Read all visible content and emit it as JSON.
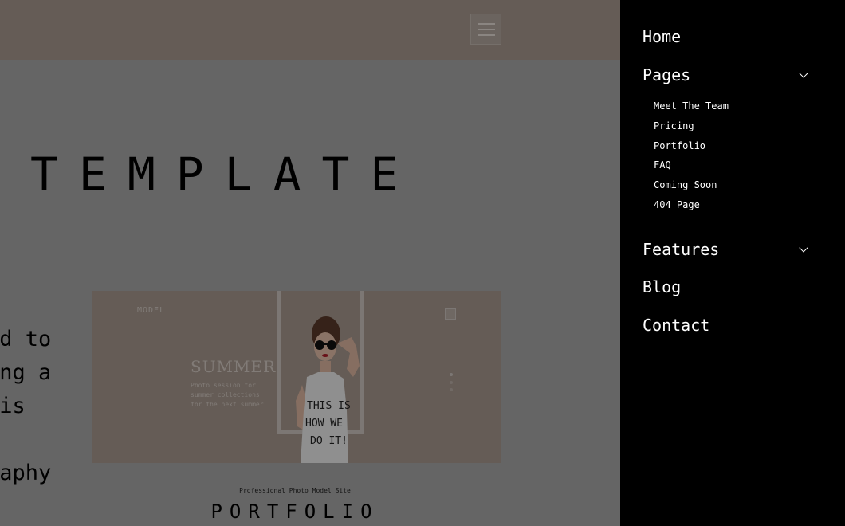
{
  "page": {
    "hero_title": "TEMPLATE",
    "body_lines": [
      "ed to",
      "ing a",
      "his",
      "raphy"
    ],
    "preview": {
      "brand": "MODEL",
      "heading": "SUMMER",
      "caption": "Photo session for summer collections for the next summer",
      "shirt_text": [
        "THIS IS",
        "HOW WE",
        "DO IT!"
      ]
    },
    "tagline": "Professional Photo Model Site",
    "section_title": "PORTFOLIO"
  },
  "drawer": {
    "home": "Home",
    "pages": "Pages",
    "pages_items": [
      "Meet The Team",
      "Pricing",
      "Portfolio",
      "FAQ",
      "Coming Soon",
      "404 Page"
    ],
    "features": "Features",
    "blog": "Blog",
    "contact": "Contact"
  },
  "colors": {
    "header_bg": "#a89a90",
    "page_bg": "#a8a8a8",
    "drawer_bg": "#000000",
    "drawer_text": "#ffffff"
  },
  "icons": {
    "menu": "hamburger-icon",
    "expand": "chevron-down-icon"
  }
}
